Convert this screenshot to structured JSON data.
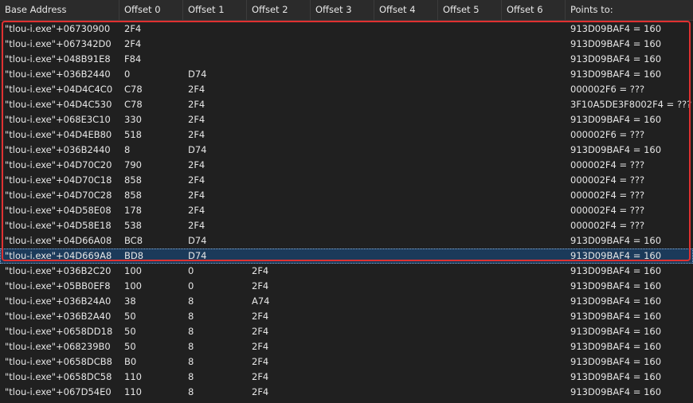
{
  "columns": [
    "Base Address",
    "Offset 0",
    "Offset 1",
    "Offset 2",
    "Offset 3",
    "Offset 4",
    "Offset 5",
    "Offset 6",
    "Points to:"
  ],
  "rows": [
    [
      "\"tlou-i.exe\"+06730900",
      "2F4",
      "",
      "",
      "",
      "",
      "",
      "",
      "913D09BAF4 = 160"
    ],
    [
      "\"tlou-i.exe\"+067342D0",
      "2F4",
      "",
      "",
      "",
      "",
      "",
      "",
      "913D09BAF4 = 160"
    ],
    [
      "\"tlou-i.exe\"+048B91E8",
      "F84",
      "",
      "",
      "",
      "",
      "",
      "",
      "913D09BAF4 = 160"
    ],
    [
      "\"tlou-i.exe\"+036B2440",
      "0",
      "D74",
      "",
      "",
      "",
      "",
      "",
      "913D09BAF4 = 160"
    ],
    [
      "\"tlou-i.exe\"+04D4C4C0",
      "C78",
      "2F4",
      "",
      "",
      "",
      "",
      "",
      "000002F6 = ???"
    ],
    [
      "\"tlou-i.exe\"+04D4C530",
      "C78",
      "2F4",
      "",
      "",
      "",
      "",
      "",
      "3F10A5DE3F8002F4 = ???"
    ],
    [
      "\"tlou-i.exe\"+068E3C10",
      "330",
      "2F4",
      "",
      "",
      "",
      "",
      "",
      "913D09BAF4 = 160"
    ],
    [
      "\"tlou-i.exe\"+04D4EB80",
      "518",
      "2F4",
      "",
      "",
      "",
      "",
      "",
      "000002F6 = ???"
    ],
    [
      "\"tlou-i.exe\"+036B2440",
      "8",
      "D74",
      "",
      "",
      "",
      "",
      "",
      "913D09BAF4 = 160"
    ],
    [
      "\"tlou-i.exe\"+04D70C20",
      "790",
      "2F4",
      "",
      "",
      "",
      "",
      "",
      "000002F4 = ???"
    ],
    [
      "\"tlou-i.exe\"+04D70C18",
      "858",
      "2F4",
      "",
      "",
      "",
      "",
      "",
      "000002F4 = ???"
    ],
    [
      "\"tlou-i.exe\"+04D70C28",
      "858",
      "2F4",
      "",
      "",
      "",
      "",
      "",
      "000002F4 = ???"
    ],
    [
      "\"tlou-i.exe\"+04D58E08",
      "178",
      "2F4",
      "",
      "",
      "",
      "",
      "",
      "000002F4 = ???"
    ],
    [
      "\"tlou-i.exe\"+04D58E18",
      "538",
      "2F4",
      "",
      "",
      "",
      "",
      "",
      "000002F4 = ???"
    ],
    [
      "\"tlou-i.exe\"+04D66A08",
      "BC8",
      "D74",
      "",
      "",
      "",
      "",
      "",
      "913D09BAF4 = 160"
    ],
    [
      "\"tlou-i.exe\"+04D669A8",
      "BD8",
      "D74",
      "",
      "",
      "",
      "",
      "",
      "913D09BAF4 = 160"
    ],
    [
      "\"tlou-i.exe\"+036B2C20",
      "100",
      "0",
      "2F4",
      "",
      "",
      "",
      "",
      "913D09BAF4 = 160"
    ],
    [
      "\"tlou-i.exe\"+05BB0EF8",
      "100",
      "0",
      "2F4",
      "",
      "",
      "",
      "",
      "913D09BAF4 = 160"
    ],
    [
      "\"tlou-i.exe\"+036B24A0",
      "38",
      "8",
      "A74",
      "",
      "",
      "",
      "",
      "913D09BAF4 = 160"
    ],
    [
      "\"tlou-i.exe\"+036B2A40",
      "50",
      "8",
      "2F4",
      "",
      "",
      "",
      "",
      "913D09BAF4 = 160"
    ],
    [
      "\"tlou-i.exe\"+0658DD18",
      "50",
      "8",
      "2F4",
      "",
      "",
      "",
      "",
      "913D09BAF4 = 160"
    ],
    [
      "\"tlou-i.exe\"+068239B0",
      "50",
      "8",
      "2F4",
      "",
      "",
      "",
      "",
      "913D09BAF4 = 160"
    ],
    [
      "\"tlou-i.exe\"+0658DCB8",
      "B0",
      "8",
      "2F4",
      "",
      "",
      "",
      "",
      "913D09BAF4 = 160"
    ],
    [
      "\"tlou-i.exe\"+0658DC58",
      "110",
      "8",
      "2F4",
      "",
      "",
      "",
      "",
      "913D09BAF4 = 160"
    ],
    [
      "\"tlou-i.exe\"+067D54E0",
      "110",
      "8",
      "2F4",
      "",
      "",
      "",
      "",
      "913D09BAF4 = 160"
    ]
  ],
  "selected_row": 15,
  "colors": {
    "background": "#202020",
    "header": "#2b2b2b",
    "selection": "#1b3a5a",
    "highlight_border": "#e03131"
  }
}
